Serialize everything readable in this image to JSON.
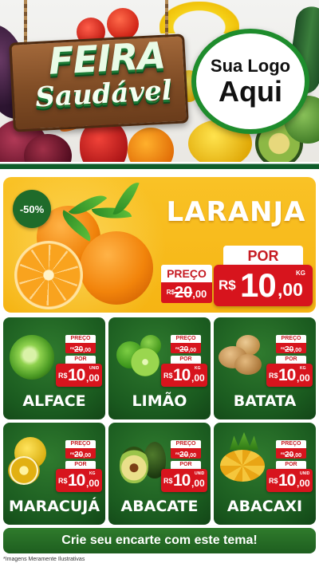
{
  "header": {
    "title_main": "FEIRA",
    "title_sub": "Saudável",
    "logo_line1": "Sua Logo",
    "logo_line2": "Aqui"
  },
  "featured": {
    "discount": "-50%",
    "name": "LARANJA",
    "old_label": "PREÇO",
    "old_currency": "R$",
    "old_value": "20",
    "old_cents": ",00",
    "new_label": "POR",
    "new_currency": "R$",
    "new_value": "10",
    "new_cents": ",00",
    "unit": "KG"
  },
  "products": [
    {
      "name": "ALFACE",
      "old_label": "PREÇO",
      "old_currency": "R$",
      "old_value": "20",
      "old_cents": ",00",
      "new_label": "POR",
      "currency": "R$",
      "value": "10",
      "cents": ",00",
      "unit": "UNID"
    },
    {
      "name": "LIMÃO",
      "old_label": "PREÇO",
      "old_currency": "R$",
      "old_value": "20",
      "old_cents": ",00",
      "new_label": "POR",
      "currency": "R$",
      "value": "10",
      "cents": ",00",
      "unit": "KG"
    },
    {
      "name": "BATATA",
      "old_label": "PREÇO",
      "old_currency": "R$",
      "old_value": "20",
      "old_cents": ",00",
      "new_label": "POR",
      "currency": "R$",
      "value": "10",
      "cents": ",00",
      "unit": "KG"
    },
    {
      "name": "MARACUJÁ",
      "old_label": "PREÇO",
      "old_currency": "R$",
      "old_value": "20",
      "old_cents": ",00",
      "new_label": "POR",
      "currency": "R$",
      "value": "10",
      "cents": ",00",
      "unit": "KG"
    },
    {
      "name": "ABACATE",
      "old_label": "PREÇO",
      "old_currency": "R$",
      "old_value": "20",
      "old_cents": ",00",
      "new_label": "POR",
      "currency": "R$",
      "value": "10",
      "cents": ",00",
      "unit": "UNID"
    },
    {
      "name": "ABACAXI",
      "old_label": "PREÇO",
      "old_currency": "R$",
      "old_value": "20",
      "old_cents": ",00",
      "new_label": "POR",
      "currency": "R$",
      "value": "10",
      "cents": ",00",
      "unit": "UNID"
    }
  ],
  "cta": "Crie seu encarte com este tema!",
  "footnote": "*Imagens Meramente Ilustrativas",
  "colors": {
    "green_dark": "#1a5a1f",
    "price_red": "#d7141d",
    "hero_yellow": "#f6b413"
  },
  "icons": {
    "logo_badge": "circle-logo-badge",
    "wood_sign": "wooden-sign"
  }
}
